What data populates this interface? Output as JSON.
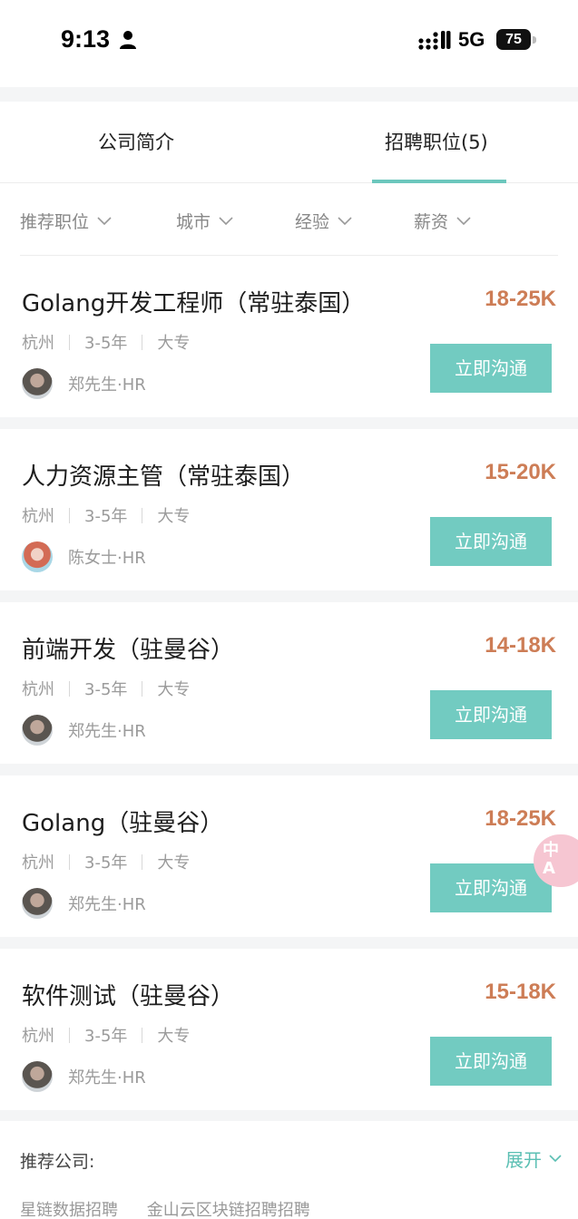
{
  "status_bar": {
    "time": "9:13",
    "network": "5G",
    "battery": "75"
  },
  "tabs": [
    {
      "label": "公司简介",
      "active": false
    },
    {
      "label": "招聘职位(5)",
      "active": true
    }
  ],
  "filters": [
    "推荐职位",
    "城市",
    "经验",
    "薪资"
  ],
  "jobs": [
    {
      "title": "Golang开发工程师（常驻泰国）",
      "salary": "18-25K",
      "city": "杭州",
      "experience": "3-5年",
      "education": "大专",
      "recruiter": "郑先生·HR",
      "avatar": "male",
      "action": "立即沟通"
    },
    {
      "title": "人力资源主管（常驻泰国）",
      "salary": "15-20K",
      "city": "杭州",
      "experience": "3-5年",
      "education": "大专",
      "recruiter": "陈女士·HR",
      "avatar": "female",
      "action": "立即沟通"
    },
    {
      "title": "前端开发（驻曼谷）",
      "salary": "14-18K",
      "city": "杭州",
      "experience": "3-5年",
      "education": "大专",
      "recruiter": "郑先生·HR",
      "avatar": "male",
      "action": "立即沟通"
    },
    {
      "title": "Golang（驻曼谷）",
      "salary": "18-25K",
      "city": "杭州",
      "experience": "3-5年",
      "education": "大专",
      "recruiter": "郑先生·HR",
      "avatar": "male",
      "action": "立即沟通"
    },
    {
      "title": "软件测试（驻曼谷）",
      "salary": "15-18K",
      "city": "杭州",
      "experience": "3-5年",
      "education": "大专",
      "recruiter": "郑先生·HR",
      "avatar": "male",
      "action": "立即沟通"
    }
  ],
  "floating_badge": {
    "text": "中A"
  },
  "recommended": {
    "label": "推荐公司:",
    "expand_label": "展开",
    "companies": [
      "星链数据招聘",
      "金山云区块链招聘招聘"
    ]
  },
  "colors": {
    "accent": "#72cbc1",
    "salary": "#cd7d56",
    "tab_indicator": "#6cc7bd"
  }
}
